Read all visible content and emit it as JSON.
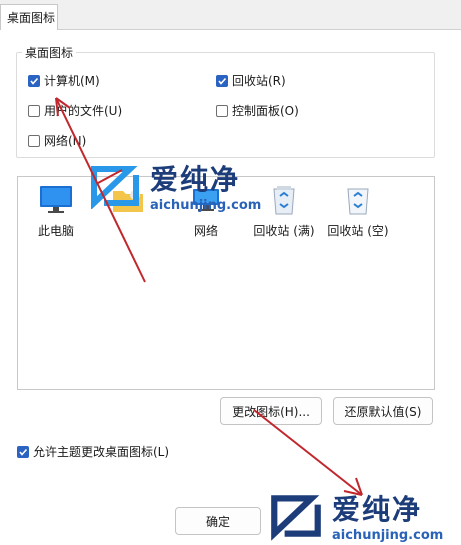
{
  "tab": {
    "label": "桌面图标"
  },
  "group": {
    "title": "桌面图标",
    "checkboxes": [
      {
        "label": "计算机(M)",
        "checked": true
      },
      {
        "label": "回收站(R)",
        "checked": true
      },
      {
        "label": "用户的文件(U)",
        "checked": false
      },
      {
        "label": "控制面板(O)",
        "checked": false
      },
      {
        "label": "网络(N)",
        "checked": false
      }
    ]
  },
  "icons": [
    {
      "label": "此电脑",
      "icon": "monitor-icon"
    },
    {
      "label": "",
      "icon": "user-folder-icon"
    },
    {
      "label": "网络",
      "icon": "network-icon"
    },
    {
      "label": "回收站 (满)",
      "icon": "recycle-bin-full-icon"
    },
    {
      "label": "回收站 (空)",
      "icon": "recycle-bin-empty-icon"
    }
  ],
  "buttons": {
    "change_icon": "更改图标(H)...",
    "restore_default": "还原默认值(S)",
    "ok": "确定"
  },
  "allow_themes": {
    "label": "允许主题更改桌面图标(L)",
    "checked": true
  },
  "watermark": {
    "brand": "爱纯净",
    "url": "aichunjing.com"
  },
  "colors": {
    "accent": "#2a63c1",
    "annotation_arrow": "#c0282d"
  }
}
